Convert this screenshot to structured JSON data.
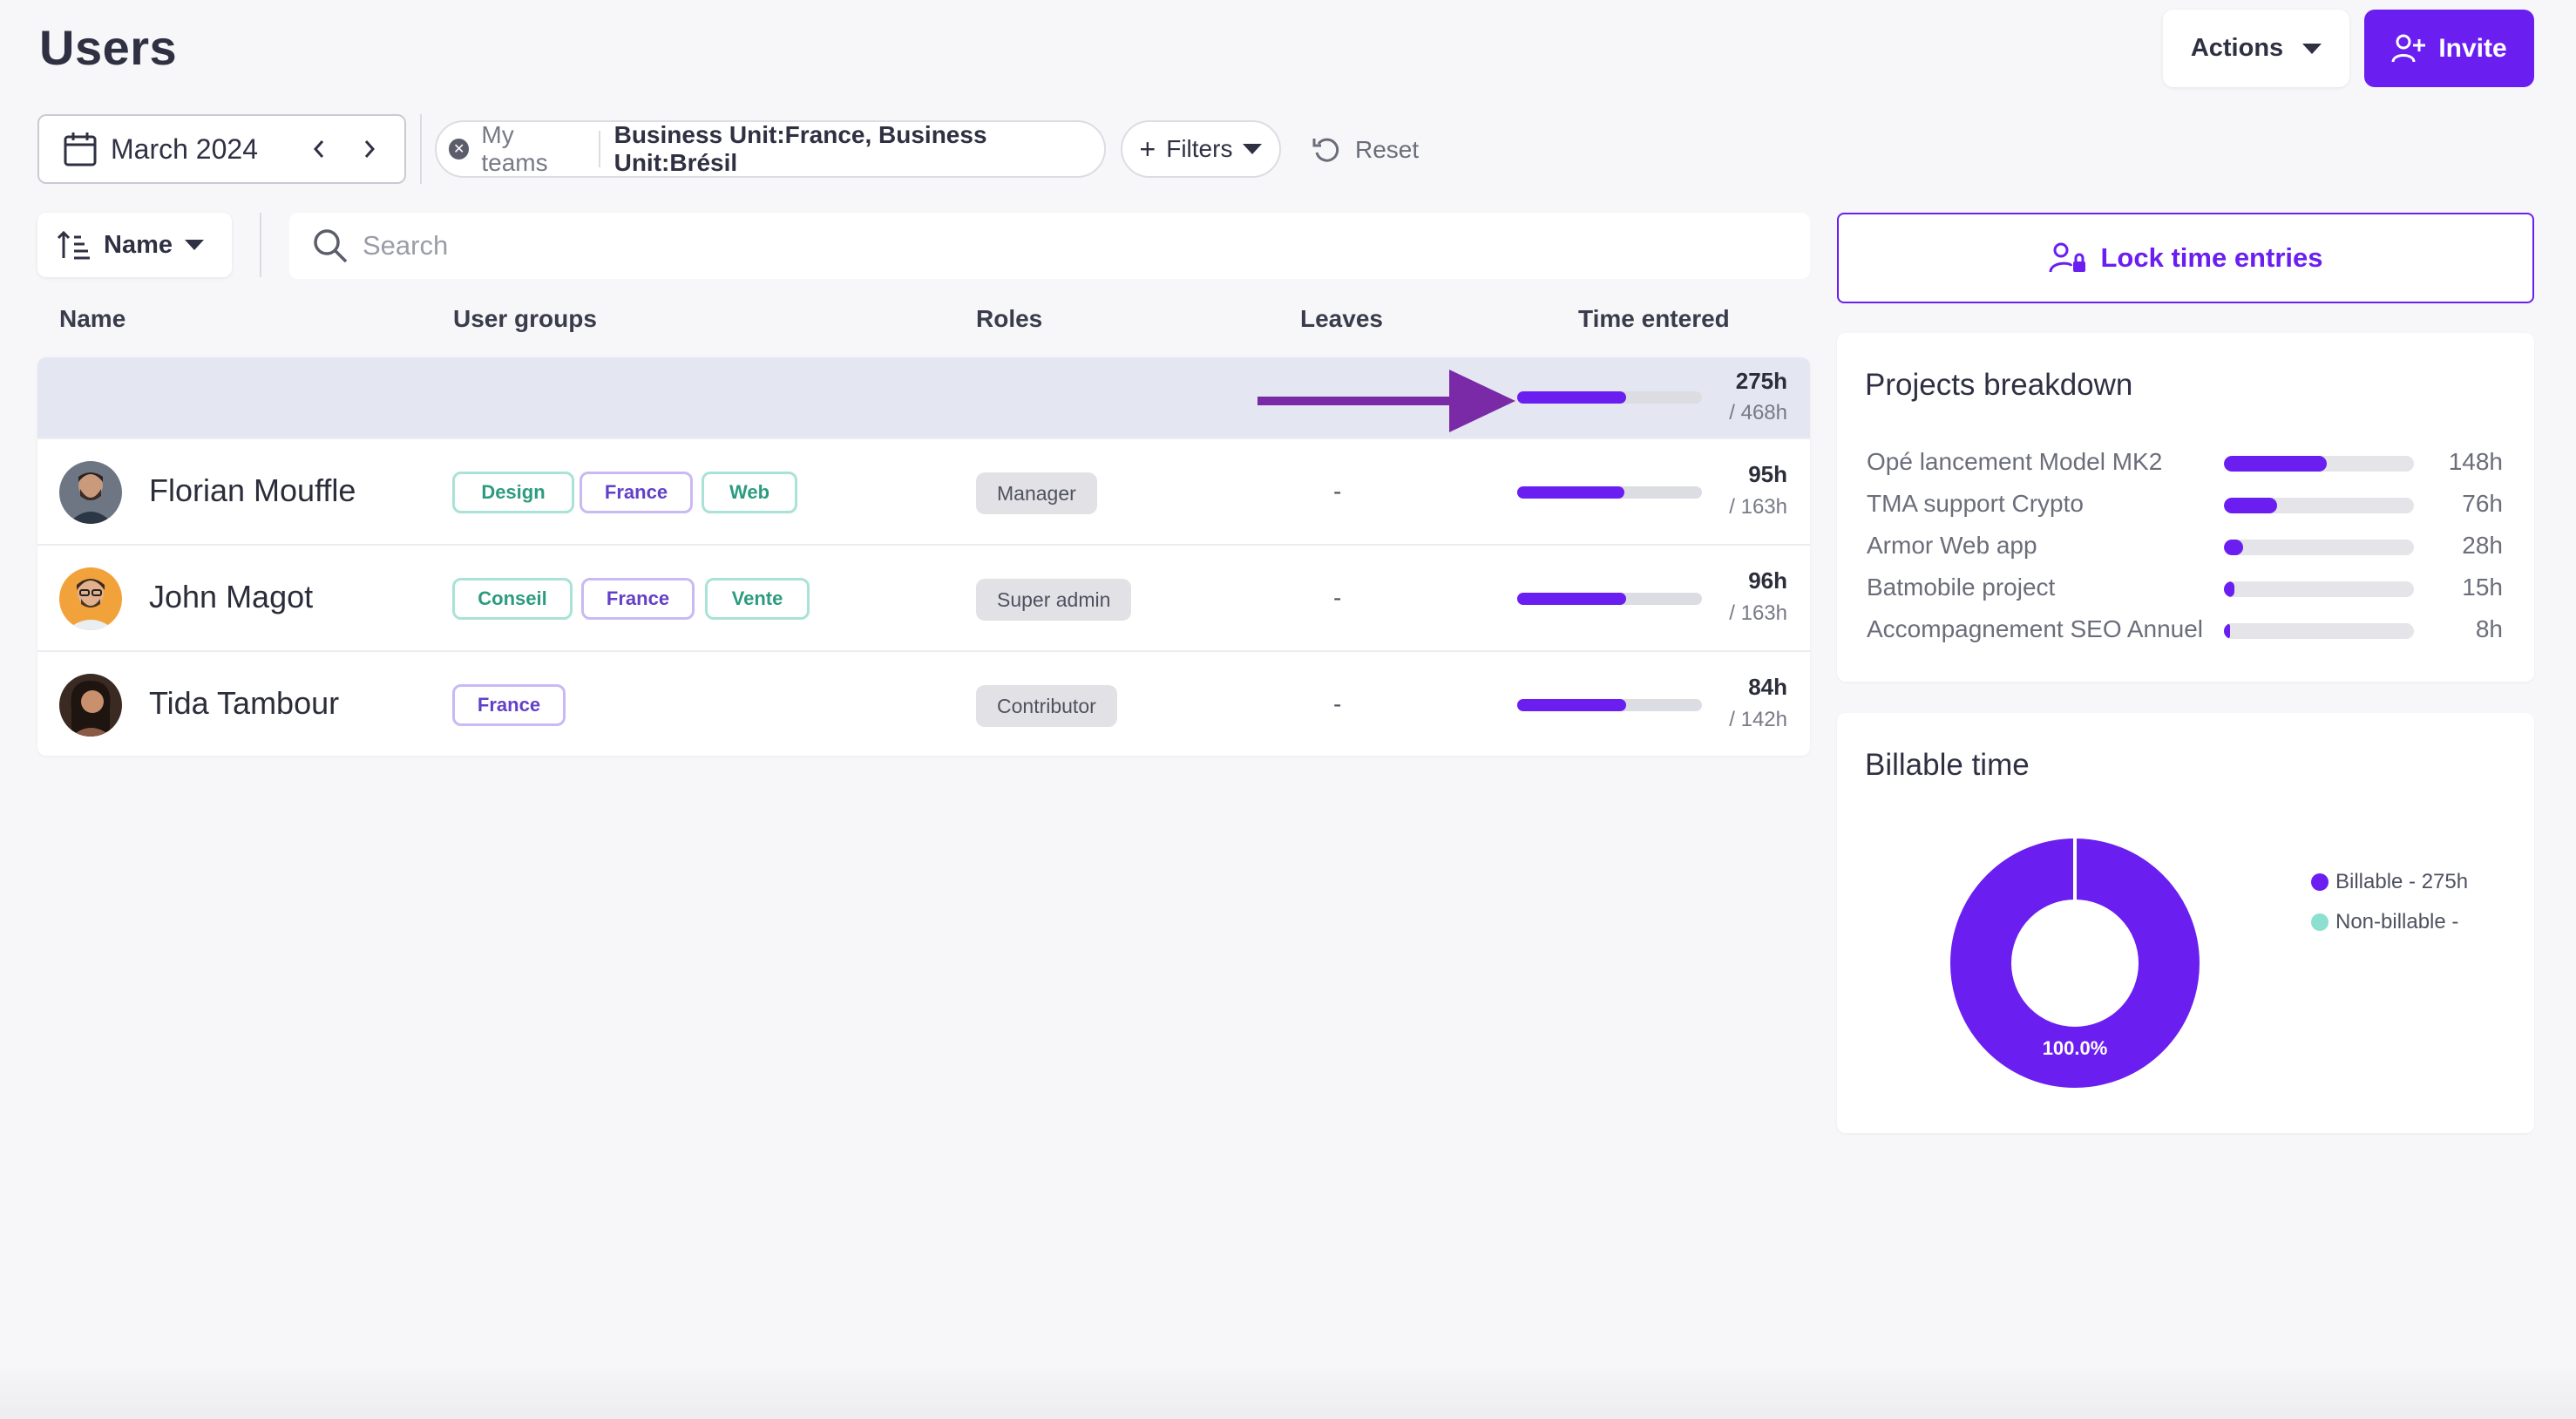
{
  "header": {
    "title": "Users",
    "actions_label": "Actions",
    "invite_label": "Invite"
  },
  "filters": {
    "month": "March 2024",
    "my_teams_label": "My teams",
    "teams_value": "Business Unit:France, Business Unit:Brésil",
    "filters_label": "Filters",
    "reset_label": "Reset"
  },
  "toolbar": {
    "sort_label": "Name",
    "search_placeholder": "Search",
    "lock_label": "Lock time entries"
  },
  "table": {
    "columns": [
      "Name",
      "User groups",
      "Roles",
      "Leaves",
      "Time entered"
    ],
    "total": {
      "hours": "275h",
      "capacity": "/ 468h",
      "progress": 0.59
    },
    "rows": [
      {
        "name": "Florian Mouffle",
        "groups": [
          {
            "label": "Design",
            "color": "green"
          },
          {
            "label": "France",
            "color": "purple"
          },
          {
            "label": "Web",
            "color": "green"
          }
        ],
        "role": "Manager",
        "leaves": "-",
        "hours": "95h",
        "capacity": "/ 163h",
        "progress": 0.58
      },
      {
        "name": "John Magot",
        "groups": [
          {
            "label": "Conseil",
            "color": "green"
          },
          {
            "label": "France",
            "color": "purple"
          },
          {
            "label": "Vente",
            "color": "green"
          }
        ],
        "role": "Super admin",
        "leaves": "-",
        "hours": "96h",
        "capacity": "/ 163h",
        "progress": 0.59
      },
      {
        "name": "Tida Tambour",
        "groups": [
          {
            "label": "France",
            "color": "purple"
          }
        ],
        "role": "Contributor",
        "leaves": "-",
        "hours": "84h",
        "capacity": "/ 142h",
        "progress": 0.59
      }
    ]
  },
  "projects": {
    "title": "Projects breakdown",
    "items": [
      {
        "name": "Opé lancement Model MK2",
        "value": "148h",
        "progress": 0.54
      },
      {
        "name": "TMA support Crypto",
        "value": "76h",
        "progress": 0.28
      },
      {
        "name": "Armor Web app",
        "value": "28h",
        "progress": 0.1
      },
      {
        "name": "Batmobile project",
        "value": "15h",
        "progress": 0.055
      },
      {
        "name": "Accompagnement SEO Annuel",
        "value": "8h",
        "progress": 0.03
      }
    ]
  },
  "billable": {
    "title": "Billable time",
    "percent_label": "100.0%",
    "legend": [
      {
        "label": "Billable - 275h",
        "color": "#6a1ff0"
      },
      {
        "label": "Non-billable -",
        "color": "#8ddfd0"
      }
    ]
  },
  "colors": {
    "accent": "#6a1ff0",
    "annotation_arrow": "#7a2aa6"
  }
}
